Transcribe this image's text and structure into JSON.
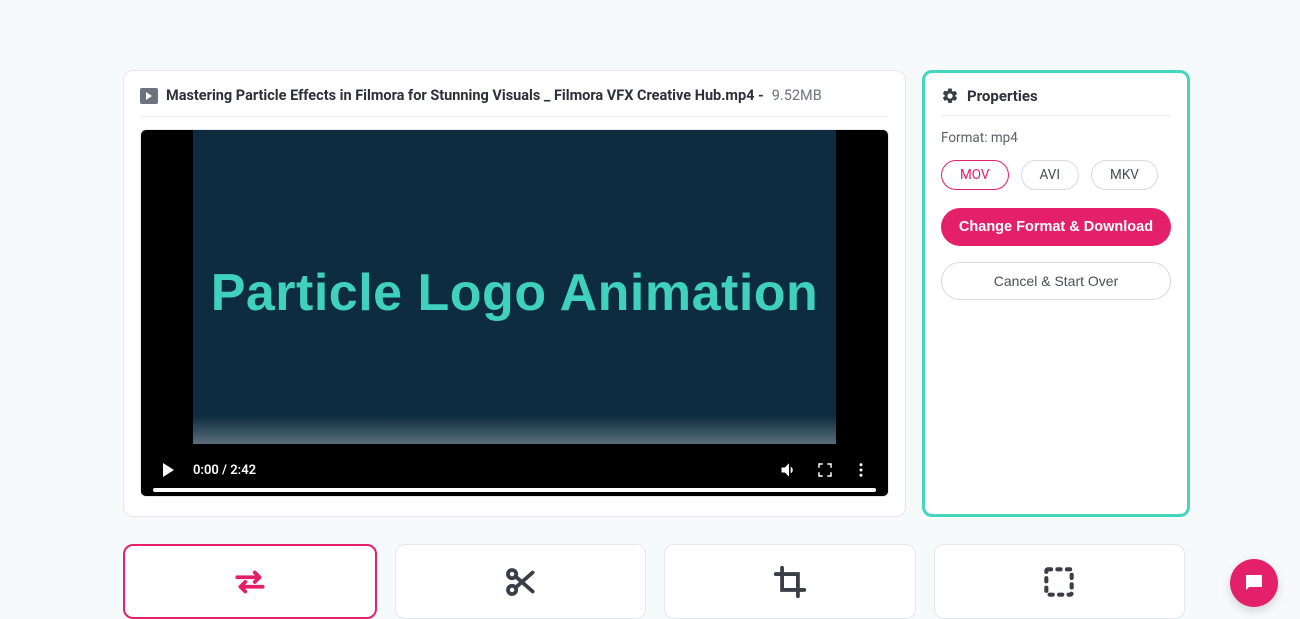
{
  "file": {
    "name": "Mastering Particle Effects in Filmora for Stunning Visuals _ Filmora VFX Creative Hub.mp4 -",
    "size": "9.52MB"
  },
  "video": {
    "headline": "Particle Logo Animation",
    "time": "0:00 / 2:42"
  },
  "properties": {
    "title": "Properties",
    "format_label": "Format: mp4",
    "options": {
      "mov": "MOV",
      "avi": "AVI",
      "mkv": "MKV"
    },
    "change_btn": "Change Format & Download",
    "cancel_btn": "Cancel & Start Over"
  }
}
